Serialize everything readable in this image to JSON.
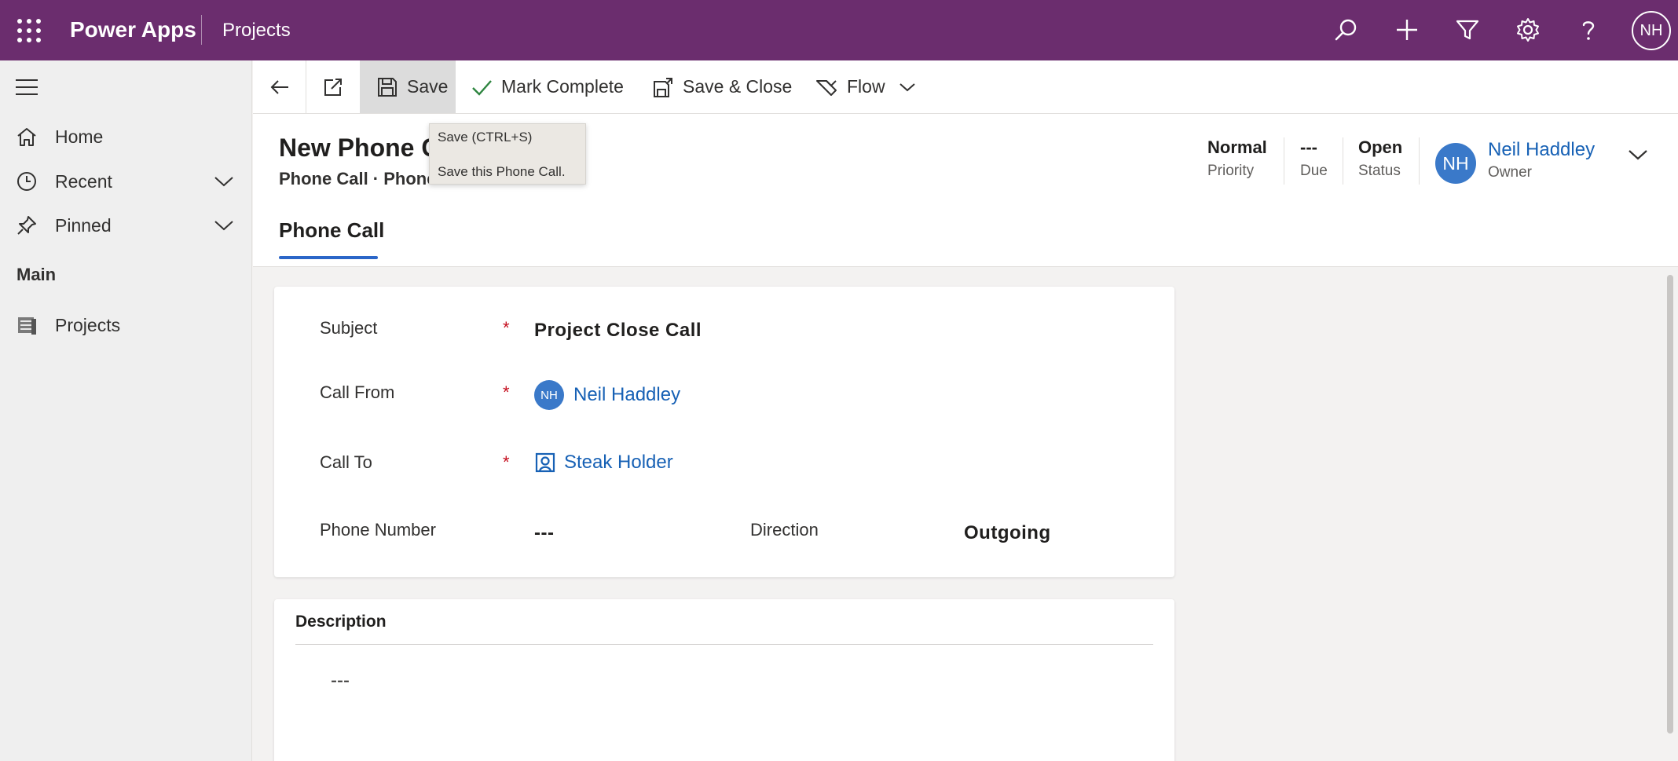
{
  "topbar": {
    "app_name": "Power Apps",
    "breadcrumb": "Projects",
    "avatar_initials": "NH",
    "color": "#6b2d6e"
  },
  "sidebar": {
    "items": [
      {
        "label": "Home",
        "icon": "home-icon"
      },
      {
        "label": "Recent",
        "icon": "clock-icon"
      },
      {
        "label": "Pinned",
        "icon": "pin-icon"
      }
    ],
    "section_label": "Main",
    "section_items": [
      {
        "label": "Projects",
        "icon": "projects-entity-icon"
      }
    ]
  },
  "commandbar": {
    "save_label": "Save",
    "mark_complete_label": "Mark Complete",
    "save_close_label": "Save & Close",
    "flow_label": "Flow"
  },
  "tooltip": {
    "line1": "Save (CTRL+S)",
    "line2": "Save this Phone Call."
  },
  "header": {
    "title": "New Phone C",
    "subtitle": "Phone Call  ·  Phone Call",
    "fields": [
      {
        "value": "Normal",
        "label": "Priority"
      },
      {
        "value": "---",
        "label": "Due"
      },
      {
        "value": "Open",
        "label": "Status"
      }
    ],
    "owner": {
      "initials": "NH",
      "name": "Neil Haddley",
      "label": "Owner"
    },
    "tab_label": "Phone Call",
    "accent_color": "#2b66c8"
  },
  "form": {
    "subject": {
      "label": "Subject",
      "required": "*",
      "value": "Project Close Call"
    },
    "call_from": {
      "label": "Call From",
      "required": "*",
      "initials": "NH",
      "value": "Neil Haddley"
    },
    "call_to": {
      "label": "Call To",
      "required": "*",
      "value": "Steak Holder"
    },
    "phone_number": {
      "label": "Phone Number",
      "value": "---"
    },
    "direction": {
      "label": "Direction",
      "value": "Outgoing"
    }
  },
  "description": {
    "title": "Description",
    "value": "---"
  }
}
